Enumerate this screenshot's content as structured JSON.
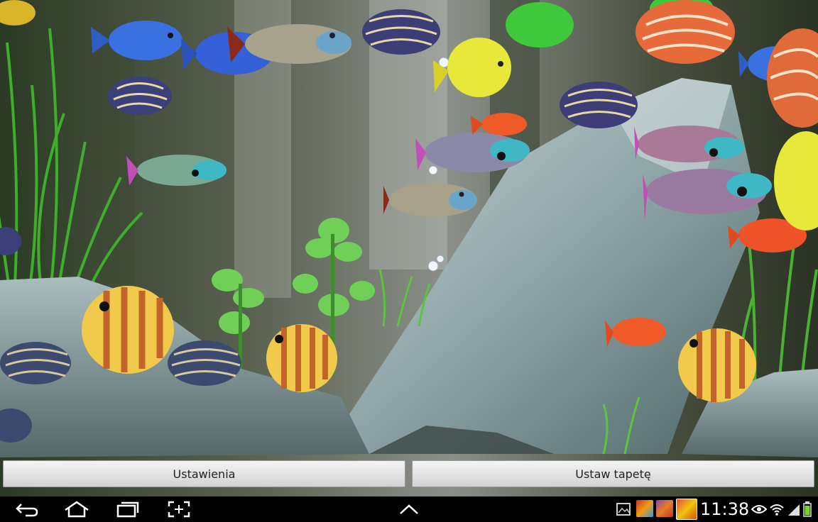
{
  "wallpaper": {
    "name": "aquarium-live-wallpaper"
  },
  "buttons": {
    "settings_label": "Ustawienia",
    "set_wallpaper_label": "Ustaw tapetę"
  },
  "navbar": {
    "back_icon": "back-arrow-icon",
    "home_icon": "home-icon",
    "recents_icon": "recent-apps-icon",
    "screenshot_icon": "screenshot-icon",
    "up_icon": "chevron-up-icon"
  },
  "status": {
    "time": "11:38",
    "icons": [
      "gallery-icon",
      "game-notification-icon",
      "game-notification-icon",
      "game-notification-icon",
      "eye-icon",
      "wifi-icon",
      "signal-icon",
      "battery-icon"
    ]
  },
  "colors": {
    "battery": "#7ed321",
    "nav_icon": "#ffffff",
    "button_bg": "#e2e2e2"
  }
}
